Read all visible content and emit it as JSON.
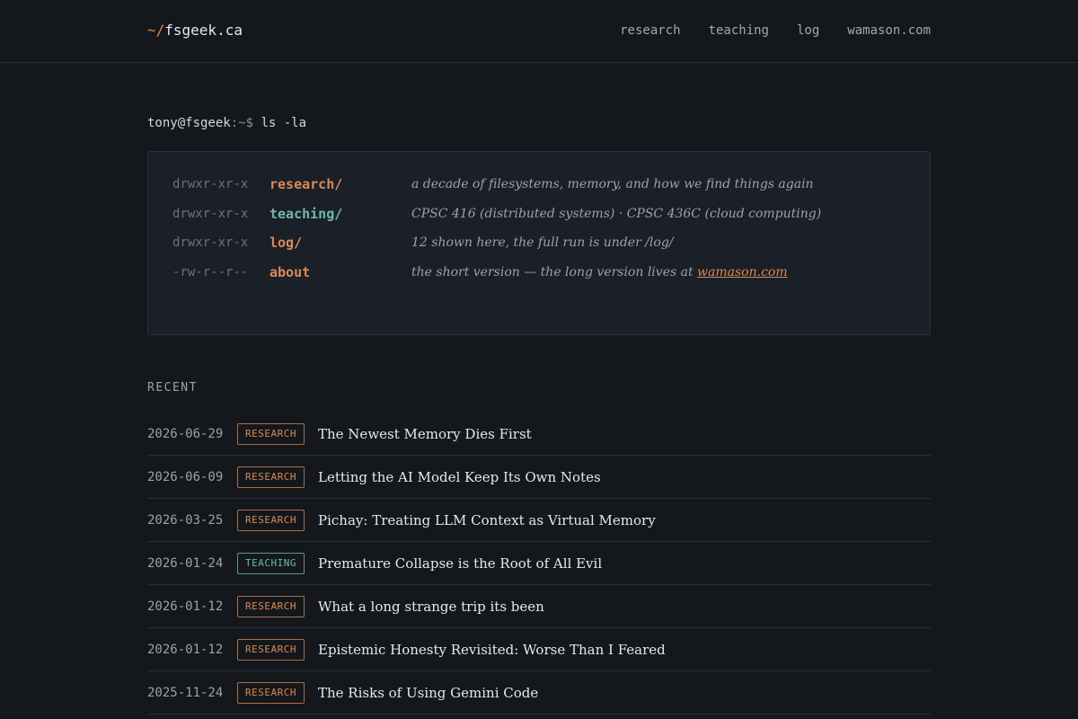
{
  "header": {
    "brand_prefix": "~/",
    "brand_name": "fsgeek.ca",
    "nav": [
      "research",
      "teaching",
      "log",
      "wamason.com"
    ]
  },
  "prompt": {
    "user": "tony@fsgeek",
    "path_sym": ":~$",
    "command": "ls -la"
  },
  "listing": [
    {
      "perm": "drwxr-xr-x",
      "name": "research/",
      "color": "#d98a55",
      "desc": "a decade of filesystems, memory, and how we find things again"
    },
    {
      "perm": "drwxr-xr-x",
      "name": "teaching/",
      "color": "#6fb8ad",
      "desc": "CPSC 416 (distributed systems) · CPSC 436C (cloud computing)"
    },
    {
      "perm": "drwxr-xr-x",
      "name": "log/",
      "color": "#d98a55",
      "desc": "12 shown here, the full run is under /log/"
    },
    {
      "perm": "-rw-r--r--",
      "name": "about",
      "color": "#d98a55",
      "desc": "the short version — the long version lives at ",
      "desc_link": "wamason.com"
    }
  ],
  "recent": {
    "label": "RECENT",
    "posts": [
      {
        "date": "2026-06-29",
        "tag": "RESEARCH",
        "title": "The Newest Memory Dies First"
      },
      {
        "date": "2026-06-09",
        "tag": "RESEARCH",
        "title": "Letting the AI Model Keep Its Own Notes"
      },
      {
        "date": "2026-03-25",
        "tag": "RESEARCH",
        "title": "Pichay: Treating LLM Context as Virtual Memory"
      },
      {
        "date": "2026-01-24",
        "tag": "TEACHING",
        "title": "Premature Collapse is the Root of All Evil"
      },
      {
        "date": "2026-01-12",
        "tag": "RESEARCH",
        "title": "What a long strange trip its been"
      },
      {
        "date": "2026-01-12",
        "tag": "RESEARCH",
        "title": "Epistemic Honesty Revisited: Worse Than I Feared"
      },
      {
        "date": "2025-11-24",
        "tag": "RESEARCH",
        "title": "The Risks of Using Gemini Code"
      }
    ]
  },
  "colors": {
    "accent_orange": "#d98a55",
    "accent_teal": "#6fb8ad",
    "background": "#14171c"
  }
}
